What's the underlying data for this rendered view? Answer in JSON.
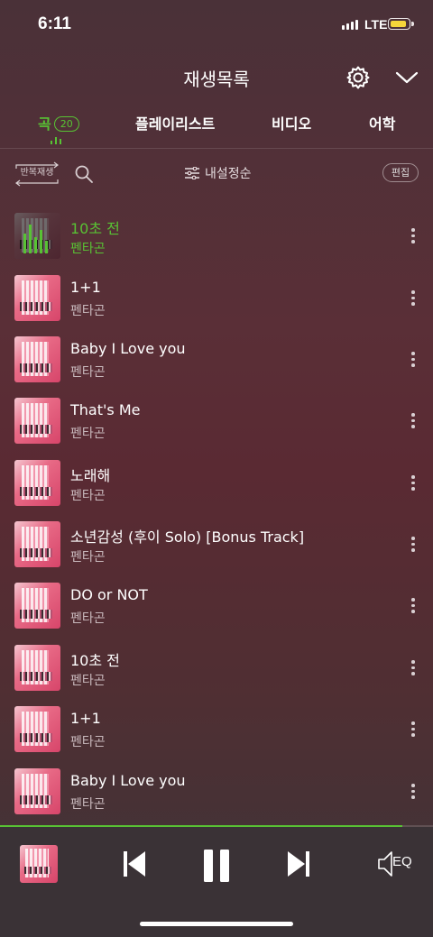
{
  "status_bar": {
    "time": "6:11",
    "network": "LTE"
  },
  "header": {
    "title": "재생목록"
  },
  "tabs": [
    {
      "label": "곡",
      "count": "20",
      "active": true
    },
    {
      "label": "플레이리스트"
    },
    {
      "label": "비디오"
    },
    {
      "label": "어학"
    }
  ],
  "toolbar": {
    "repeat_label": "반복재생",
    "sort_label": "내설정순",
    "edit_label": "편집"
  },
  "songs": [
    {
      "title": "10초 전",
      "artist": "펜타곤",
      "playing": true
    },
    {
      "title": "1+1",
      "artist": "펜타곤"
    },
    {
      "title": "Baby I Love you",
      "artist": "펜타곤"
    },
    {
      "title": "That's Me",
      "artist": "펜타곤"
    },
    {
      "title": "노래해",
      "artist": "펜타곤"
    },
    {
      "title": "소년감성 (후이 Solo) [Bonus Track]",
      "artist": "펜타곤"
    },
    {
      "title": "DO or NOT",
      "artist": "펜타곤"
    },
    {
      "title": "10초 전",
      "artist": "펜타곤"
    },
    {
      "title": "1+1",
      "artist": "펜타곤"
    },
    {
      "title": "Baby I Love you",
      "artist": "펜타곤"
    }
  ],
  "player": {
    "eq_label": "EQ",
    "progress": 0.93
  },
  "colors": {
    "accent": "#58c234",
    "background": "#5a2f37",
    "player_bg": "#3a3236"
  },
  "icons": [
    "gear-icon",
    "chevron-down-icon",
    "search-icon",
    "sort-icon",
    "more-icon",
    "previous-icon",
    "pause-icon",
    "next-icon",
    "eq-icon"
  ]
}
